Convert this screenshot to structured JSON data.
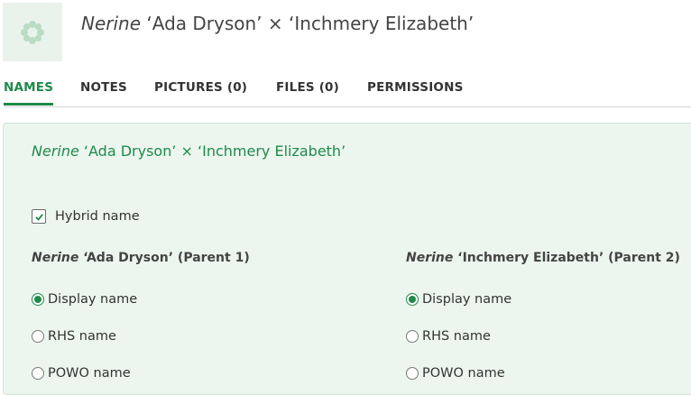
{
  "header": {
    "genus": "Nerine",
    "rest": " ‘Ada Dryson’ × ‘Inchmery Elizabeth’",
    "thumbnail_icon": "flower-icon"
  },
  "tabs": [
    {
      "label": "NAMES",
      "active": true
    },
    {
      "label": "NOTES"
    },
    {
      "label": "PICTURES (0)"
    },
    {
      "label": "FILES (0)"
    },
    {
      "label": "PERMISSIONS"
    }
  ],
  "panel": {
    "genus": "Nerine",
    "rest": " ‘Ada Dryson’ × ‘Inchmery Elizabeth’",
    "hybrid_label": "Hybrid name",
    "hybrid_checked": true
  },
  "parents": [
    {
      "genus": "Nerine",
      "rest": " ‘Ada Dryson’ (Parent 1)",
      "options": [
        "Display name",
        "RHS name",
        "POWO name"
      ],
      "selected": 0
    },
    {
      "genus": "Nerine",
      "rest": " ‘Inchmery Elizabeth’ (Parent 2)",
      "options": [
        "Display name",
        "RHS name",
        "POWO name"
      ],
      "selected": 0
    }
  ],
  "colors": {
    "accent": "#1f8a4a",
    "panel_bg": "#ecf6ef"
  }
}
